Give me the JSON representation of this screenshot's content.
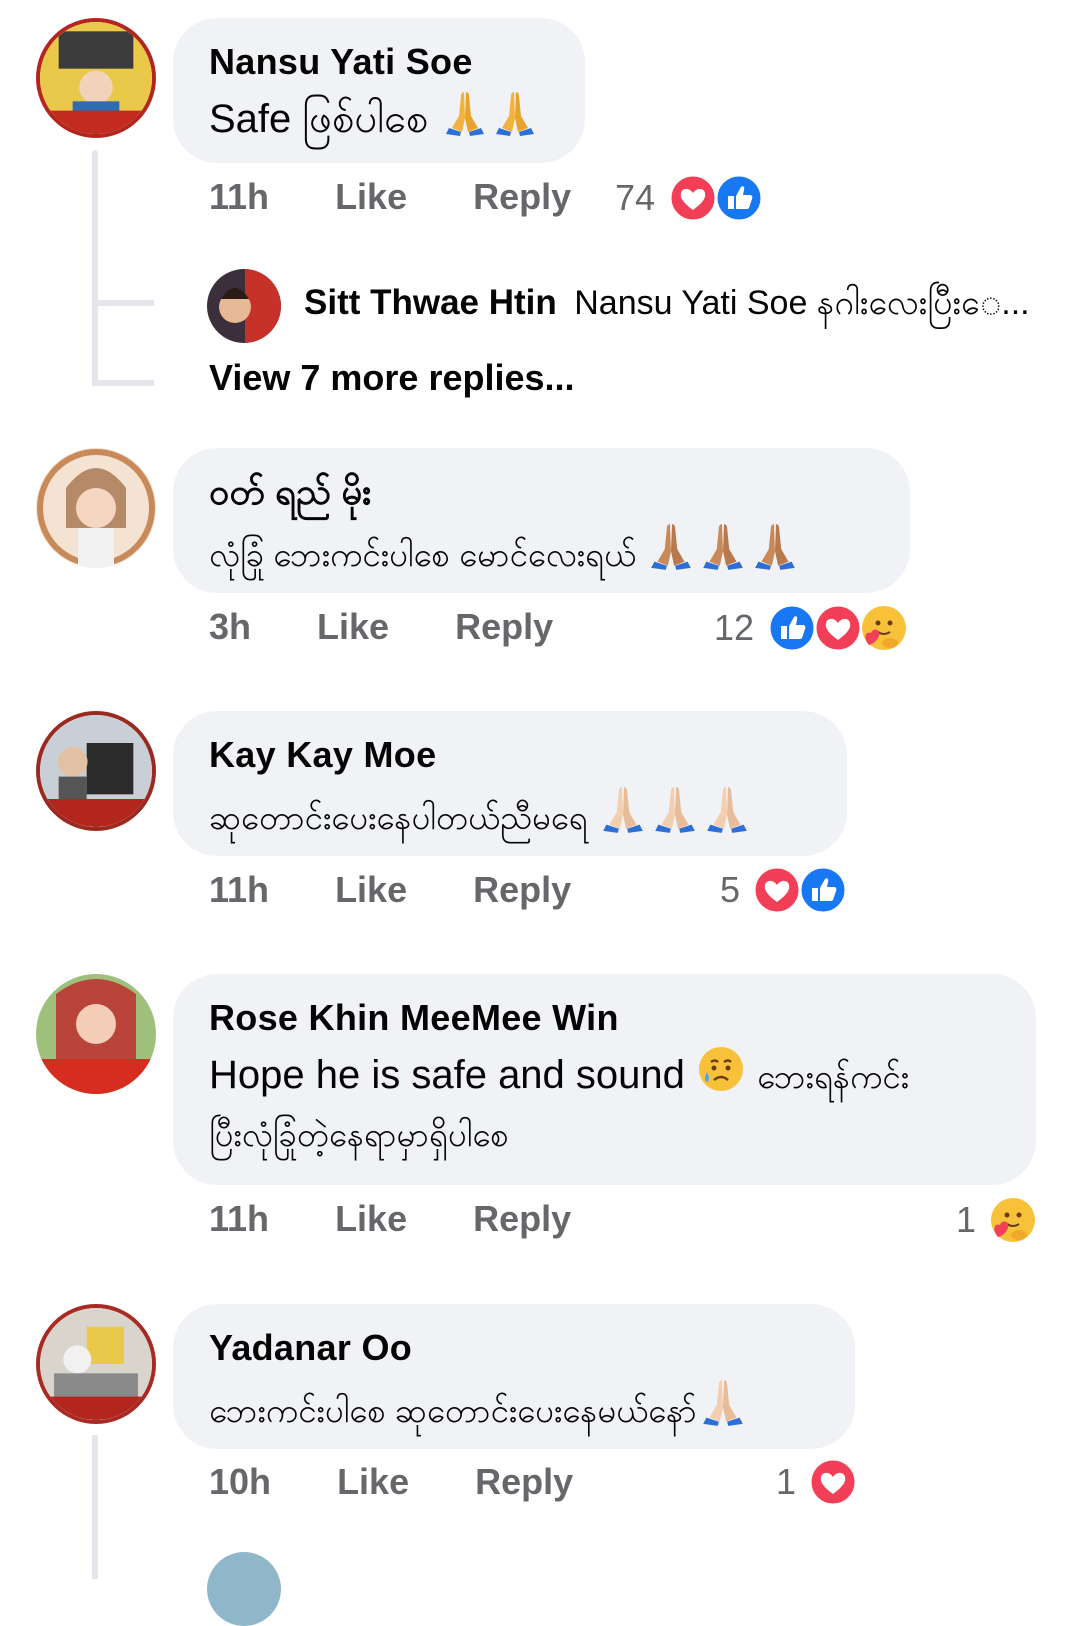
{
  "comments": [
    {
      "author": "Nansu Yati Soe",
      "text": "Safe ဖြစ်ပါစေ",
      "time": "11h",
      "like_label": "Like",
      "reply_label": "Reply",
      "reaction_count": "74",
      "reactions": [
        "love-icon",
        "like-icon"
      ],
      "emoji": [
        "folded-hands-icon",
        "folded-hands-icon"
      ],
      "avatar_color": "#b3261e"
    },
    {
      "author": "ဝတ် ရည် မိုး",
      "text": "လုံခြုံ ဘေးကင်းပါစေ မောင်လေးရယ်",
      "time": "3h",
      "like_label": "Like",
      "reply_label": "Reply",
      "reaction_count": "12",
      "reactions": [
        "like-icon",
        "love-icon",
        "care-icon"
      ],
      "emoji": [
        "folded-hands-icon",
        "folded-hands-icon",
        "folded-hands-icon"
      ],
      "avatar_color": "#d9a77a"
    },
    {
      "author": "Kay Kay Moe",
      "text": "ဆုတောင်းပေးနေပါတယ်ညီမရေ",
      "time": "11h",
      "like_label": "Like",
      "reply_label": "Reply",
      "reaction_count": "5",
      "reactions": [
        "love-icon",
        "like-icon"
      ],
      "emoji": [
        "folded-hands-icon",
        "folded-hands-icon",
        "folded-hands-icon"
      ],
      "avatar_color": "#9a2a1f"
    },
    {
      "author": "Rose Khin MeeMee Win",
      "text_line1": "Hope he is safe and sound",
      "text_line1b": "ဘေးရန်ကင်း",
      "text_line2": "ပြီးလုံခြုံတဲ့နေရာမှာရှိပါစေ",
      "time": "11h",
      "like_label": "Like",
      "reply_label": "Reply",
      "reaction_count": "1",
      "reactions": [
        "care-icon"
      ],
      "emoji": [
        "crying-face-icon"
      ],
      "avatar_color": "#d43a2a"
    },
    {
      "author": "Yadanar Oo",
      "text": "ဘေးကင်းပါစေ ဆုတောင်းပေးနေမယ်နော်",
      "time": "10h",
      "like_label": "Like",
      "reply_label": "Reply",
      "reaction_count": "1",
      "reactions": [
        "love-icon"
      ],
      "emoji": [
        "folded-hands-icon"
      ],
      "avatar_color": "#a82a22"
    }
  ],
  "reply_preview": {
    "author": "Sitt Thwae Htin",
    "text": "Nansu Yati Soe နဂါးလေးပြီးေ...",
    "view_more": "View 7 more replies..."
  },
  "colors": {
    "bubble": "#f0f2f5",
    "meta": "#65676b",
    "like_blue": "#1877f2",
    "love_red": "#f33e58"
  }
}
